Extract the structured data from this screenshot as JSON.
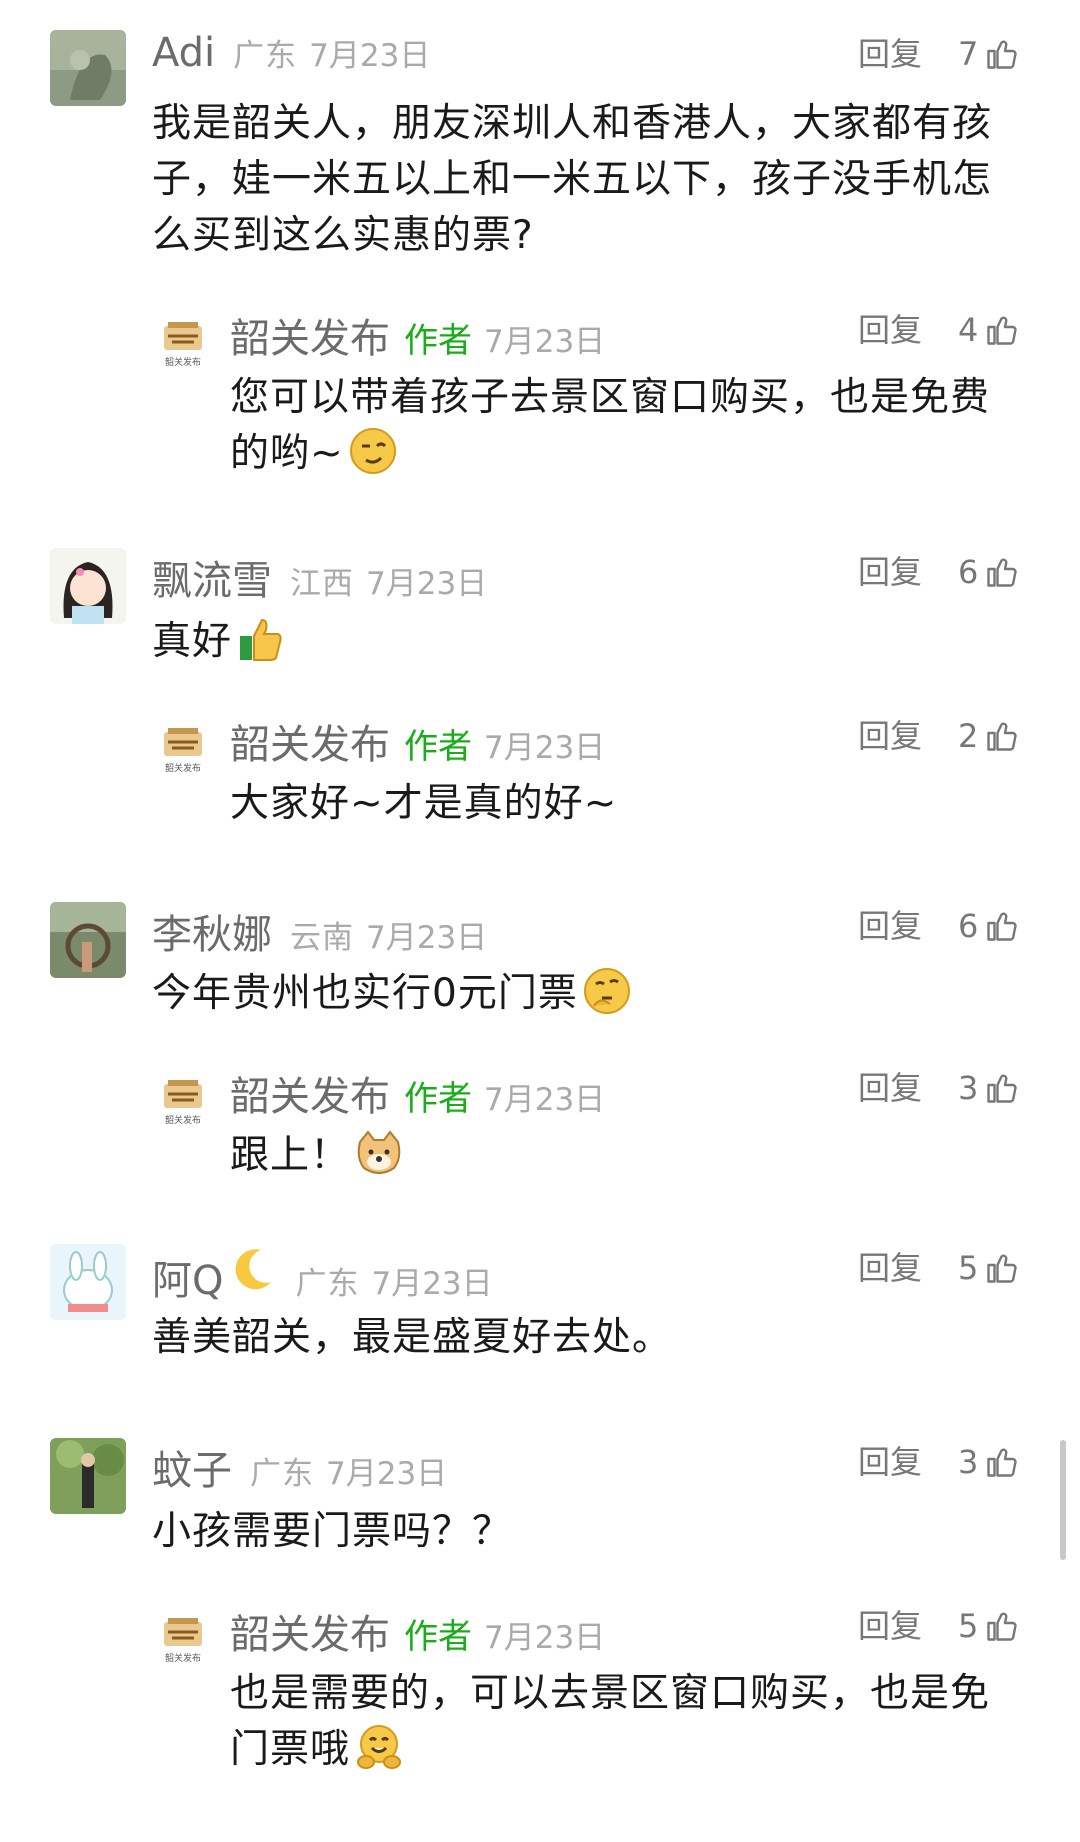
{
  "comments": [
    {
      "name": "Adi",
      "location": "广东",
      "date": "7月23日",
      "reply_label": "回复",
      "likes": "7",
      "text_lines": [
        "我是韶关人，朋友深圳人和香港人，大家都有孩",
        "子，娃一米五以上和一米五以下，孩子没手机怎",
        "么买到这么实惠的票?"
      ],
      "reply": {
        "name": "韶关发布",
        "author_tag": "作者",
        "date": "7月23日",
        "reply_label": "回复",
        "likes": "4",
        "text_lines": [
          "您可以带着孩子去景区窗口购买，也是免费",
          "的哟~"
        ],
        "emoji": "wink-emoji"
      }
    },
    {
      "name": "飘流雪",
      "location": "江西",
      "date": "7月23日",
      "reply_label": "回复",
      "likes": "6",
      "text_lines": [
        "真好"
      ],
      "emoji": "thumbs-up-emoji",
      "reply": {
        "name": "韶关发布",
        "author_tag": "作者",
        "date": "7月23日",
        "reply_label": "回复",
        "likes": "2",
        "text_lines": [
          "大家好~才是真的好~"
        ]
      }
    },
    {
      "name": "李秋娜",
      "location": "云南",
      "date": "7月23日",
      "reply_label": "回复",
      "likes": "6",
      "text_lines": [
        "今年贵州也实行0元门票"
      ],
      "emoji": "thinking-emoji",
      "reply": {
        "name": "韶关发布",
        "author_tag": "作者",
        "date": "7月23日",
        "reply_label": "回复",
        "likes": "3",
        "text_lines": [
          "跟上！"
        ],
        "emoji": "doge-emoji"
      }
    },
    {
      "name": "阿Q",
      "location": "广东",
      "date": "7月23日",
      "reply_label": "回复",
      "likes": "5",
      "text_lines": [
        "善美韶关，最是盛夏好去处。"
      ],
      "name_emoji": "moon-emoji"
    },
    {
      "name": "蚊子",
      "location": "广东",
      "date": "7月23日",
      "reply_label": "回复",
      "likes": "3",
      "text_lines": [
        "小孩需要门票吗？？"
      ],
      "reply": {
        "name": "韶关发布",
        "author_tag": "作者",
        "date": "7月23日",
        "reply_label": "回复",
        "likes": "5",
        "text_lines": [
          "也是需要的，可以去景区窗口购买，也是免",
          "门票哦"
        ],
        "emoji": "hug-emoji"
      }
    }
  ],
  "author_logo_caption": "韶关发布",
  "colors": {
    "author_tag": "#1aad19",
    "meta": "#aaaaaa",
    "name": "#6b6b6b"
  }
}
